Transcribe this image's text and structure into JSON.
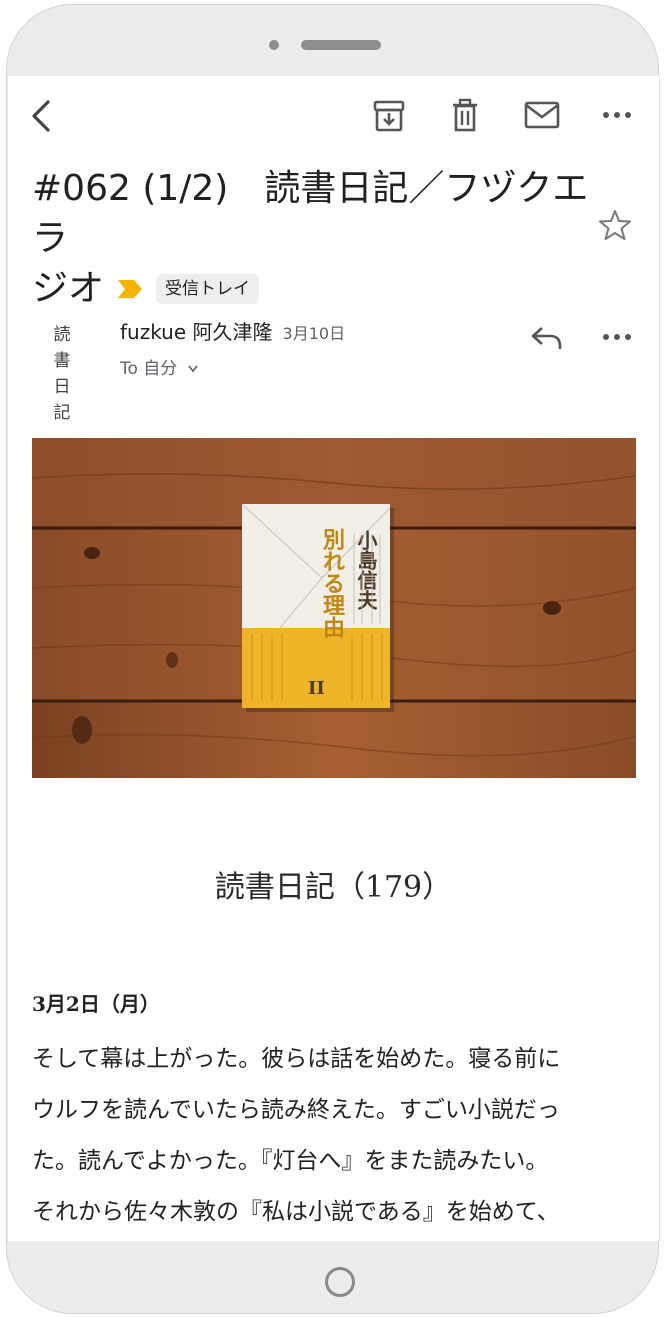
{
  "toolbar": {
    "back_icon": "arrow-left-icon",
    "archive_icon": "archive-icon",
    "delete_icon": "trash-icon",
    "mark_unread_icon": "envelope-icon",
    "more_icon": "more-horizontal-icon"
  },
  "email": {
    "subject_line1": "#062 (1/2)　読書日記／フヅクエラ",
    "subject_line2": "ジオ",
    "label": "受信トレイ",
    "label_color": "#F5B400",
    "starred": false,
    "avatar_text_line1": "読 書",
    "avatar_text_line2": "日 記",
    "sender": "fuzkue 阿久津隆",
    "date": "3月10日",
    "recipient": "To 自分",
    "recipient_chevron": "chevron-down-icon"
  },
  "body": {
    "heading": "読書日記（179）",
    "date_heading": "3月2日（月）",
    "paragraph_lines": [
      "そして幕は上がった。彼らは話を始めた。寝る前に",
      "ウルフを読んでいたら読み終えた。すごい小説だっ",
      "た。読んでよかった。『灯台へ』をまた読みたい。",
      "それから佐々木敦の『私は小説である』を始めて、"
    ]
  },
  "book_cover": {
    "author": "小島信夫",
    "title": "別れる理由",
    "volume": "II",
    "accent_color": "#F0B429"
  }
}
